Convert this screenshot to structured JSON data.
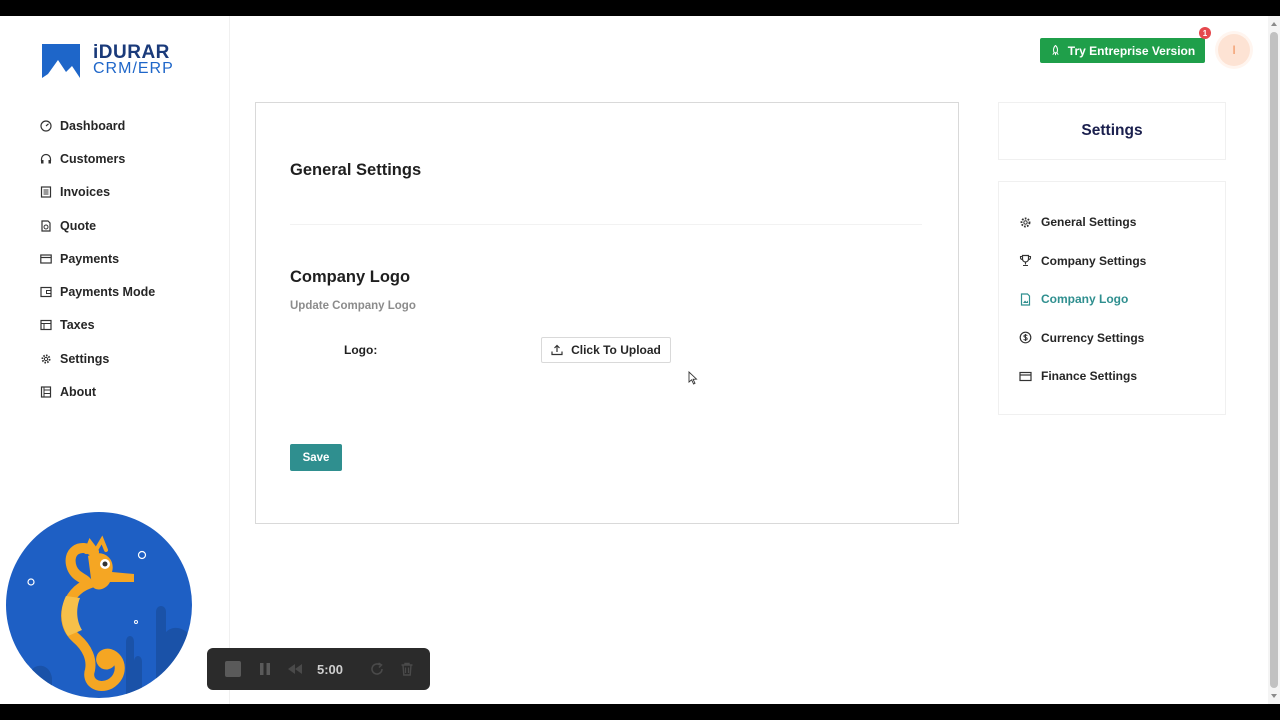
{
  "app": {
    "brand_title": "iDURAR",
    "brand_subtitle": "CRM/ERP"
  },
  "sidebar": {
    "items": [
      {
        "label": "Dashboard",
        "icon": "dashboard-icon"
      },
      {
        "label": "Customers",
        "icon": "headset-icon"
      },
      {
        "label": "Invoices",
        "icon": "container-icon"
      },
      {
        "label": "Quote",
        "icon": "file-sync-icon"
      },
      {
        "label": "Payments",
        "icon": "credit-card-icon"
      },
      {
        "label": "Payments Mode",
        "icon": "wallet-icon"
      },
      {
        "label": "Taxes",
        "icon": "shop-icon"
      },
      {
        "label": "Settings",
        "icon": "gear-icon"
      },
      {
        "label": "About",
        "icon": "reconciliation-icon"
      }
    ]
  },
  "header": {
    "try_label": "Try Entreprise Version",
    "notification_count": "1",
    "avatar_initial": "I"
  },
  "main": {
    "title": "General Settings",
    "section_title": "Company Logo",
    "section_subtitle": "Update Company Logo",
    "logo_label": "Logo",
    "logo_colon": ":",
    "upload_label": "Click To Upload",
    "save_label": "Save"
  },
  "settings_panel": {
    "title": "Settings",
    "active": "Company Logo",
    "items": [
      {
        "label": "General Settings",
        "icon": "gear-icon"
      },
      {
        "label": "Company Settings",
        "icon": "trophy-icon"
      },
      {
        "label": "Company Logo",
        "icon": "file-image-icon"
      },
      {
        "label": "Currency Settings",
        "icon": "dollar-icon"
      },
      {
        "label": "Finance Settings",
        "icon": "credit-card-icon"
      }
    ]
  },
  "recorder": {
    "time": "5:00"
  },
  "colors": {
    "accent": "#2f8f8f",
    "try_green": "#1f9f4a",
    "brand_blue": "#1e66c9",
    "badge_red": "#e5484d"
  }
}
